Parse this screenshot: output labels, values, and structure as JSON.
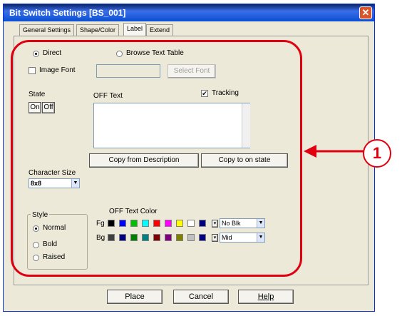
{
  "window": {
    "title": "Bit Switch Settings [BS_001]",
    "close_glyph": "✕"
  },
  "tabs": [
    {
      "label": "General Settings"
    },
    {
      "label": "Shape/Color"
    },
    {
      "label": "Label"
    },
    {
      "label": "Extend"
    }
  ],
  "label_panel": {
    "direct_label": "Direct",
    "browse_label": "Browse Text Table",
    "image_font_label": "Image Font",
    "image_font_value": "",
    "select_font_label": "Select Font",
    "state_label": "State",
    "state_on": "On",
    "state_off": "Off",
    "off_text_label": "OFF Text",
    "tracking_label": "Tracking",
    "off_text_value": "",
    "copy_from_description": "Copy from Description",
    "copy_to_on_state": "Copy to on state",
    "character_size_label": "Character Size",
    "character_size_value": "8x8",
    "style_label": "Style",
    "style_options": [
      "Normal",
      "Bold",
      "Raised"
    ],
    "off_text_color_label": "OFF Text Color",
    "fg_label": "Fg",
    "bg_label": "Bg",
    "fg_select": "No Blk",
    "bg_select": "Mid",
    "fg_colors": [
      "#000000",
      "#0000ff",
      "#00c000",
      "#00ffff",
      "#ff0000",
      "#ff00ff",
      "#ffff00",
      "#ffffff",
      "#000080"
    ],
    "bg_colors": [
      "#404040",
      "#000080",
      "#008000",
      "#008080",
      "#800000",
      "#800080",
      "#808000",
      "#c0c0c0",
      "#000080"
    ]
  },
  "footer": {
    "place": "Place",
    "cancel": "Cancel",
    "help": "Help"
  },
  "callout": {
    "number": "1"
  },
  "colors": {
    "accent_red": "#e0000f",
    "titlebar": "#0a246a"
  }
}
